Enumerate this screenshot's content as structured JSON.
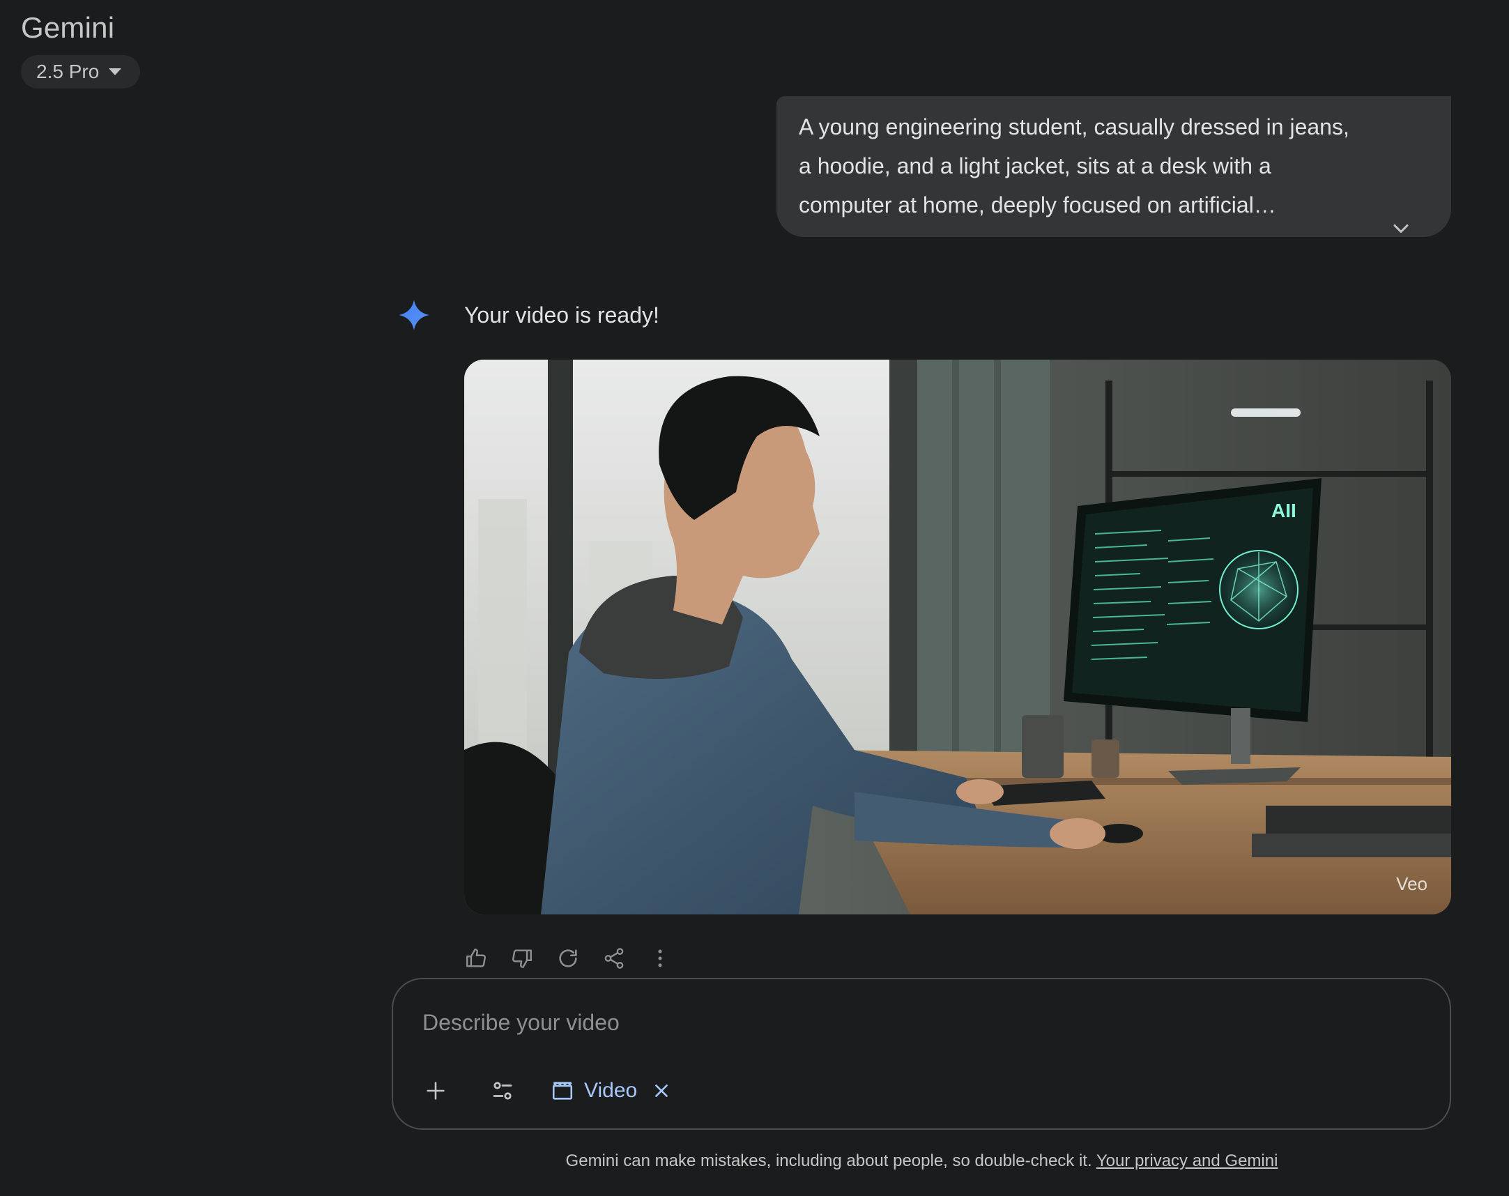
{
  "header": {
    "title": "Gemini",
    "model_label": "2.5 Pro"
  },
  "conversation": {
    "user_prompt": "A young engineering student, casually dressed in jeans, a hoodie, and a light jacket, sits at a desk with a computer at home, deeply focused on artificial…",
    "response_text": "Your video is ready!",
    "video": {
      "watermark": "Veo",
      "screen_text": "AII"
    },
    "actions": [
      "thumbs-up-icon",
      "thumbs-down-icon",
      "refresh-icon",
      "share-icon",
      "more-vert-icon"
    ]
  },
  "composer": {
    "placeholder": "Describe your video",
    "tool_chip_label": "Video"
  },
  "footer": {
    "disclaimer": "Gemini can make mistakes, including about people, so double-check it.",
    "privacy_link": "Your privacy and Gemini"
  },
  "colors": {
    "background": "#1b1c1d",
    "bubble": "#333537",
    "accent": "#a8c7fa",
    "spark_start": "#4285f4",
    "spark_end": "#9b72cb"
  }
}
